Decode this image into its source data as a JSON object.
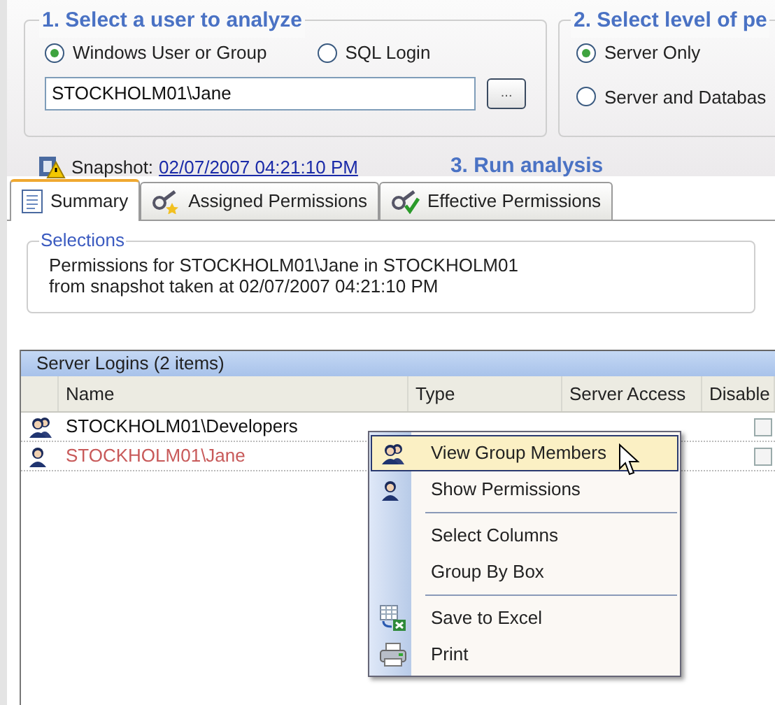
{
  "user_group": {
    "title": "1. Select a user to analyze",
    "options": [
      {
        "label": "Windows User or Group",
        "selected": true
      },
      {
        "label": "SQL Login",
        "selected": false
      }
    ],
    "user_value": "STOCKHOLM01\\Jane",
    "browse_button": "..."
  },
  "level_group": {
    "title": "2. Select level of pe",
    "options": [
      {
        "label": "Server Only",
        "selected": true
      },
      {
        "label": "Server and Databas",
        "selected": false
      }
    ]
  },
  "snapshot": {
    "label": "Snapshot:",
    "link": "02/07/2007 04:21:10 PM"
  },
  "run_analysis": "3. Run analysis",
  "tabs": [
    {
      "label": "Summary",
      "kind": "document",
      "selected": true
    },
    {
      "label": "Assigned Permissions",
      "kind": "key-star",
      "selected": false
    },
    {
      "label": "Effective Permissions",
      "kind": "key-check",
      "selected": false
    }
  ],
  "selections": {
    "title": "Selections",
    "lines": [
      "Permissions for STOCKHOLM01\\Jane in STOCKHOLM01",
      "from snapshot taken at 02/07/2007 04:21:10 PM"
    ]
  },
  "grid": {
    "title": "Server Logins (2 items)",
    "columns": [
      "Name",
      "Type",
      "Server Access",
      "Disable"
    ],
    "rows": [
      {
        "kind": "group",
        "name": "STOCKHOLM01\\Developers",
        "disabled": false,
        "highlighted": false
      },
      {
        "kind": "user",
        "name": "STOCKHOLM01\\Jane",
        "disabled": false,
        "highlighted": true
      }
    ]
  },
  "context_menu": [
    {
      "label": "View Group Members",
      "kind": "group",
      "selected": true,
      "separator_after": false
    },
    {
      "label": "Show Permissions",
      "kind": "user",
      "selected": false,
      "separator_after": true
    },
    {
      "label": "Select Columns",
      "kind": "plain",
      "selected": false,
      "separator_after": false
    },
    {
      "label": "Group By Box",
      "kind": "plain",
      "selected": false,
      "separator_after": true
    },
    {
      "label": "Save to Excel",
      "kind": "excel",
      "selected": false,
      "separator_after": false
    },
    {
      "label": "Print",
      "kind": "printer",
      "selected": false,
      "separator_after": false
    }
  ]
}
